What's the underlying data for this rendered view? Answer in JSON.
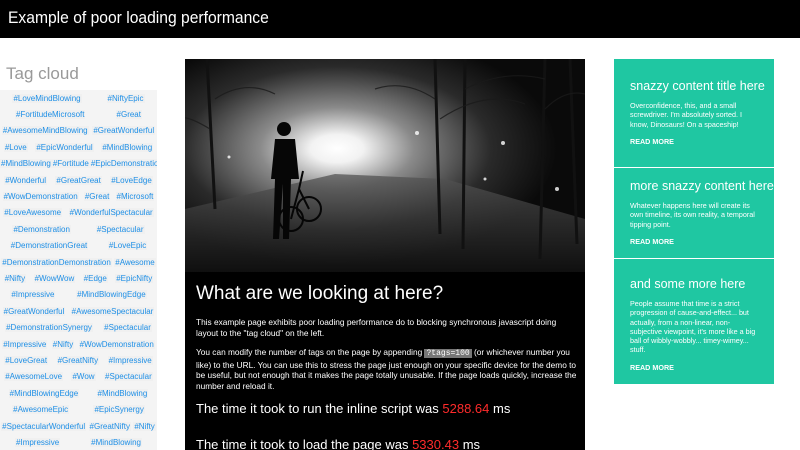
{
  "header": {
    "title": "Example of poor loading performance"
  },
  "tagcloud": {
    "title": "Tag cloud",
    "rows": [
      [
        "#LoveMindBlowing",
        "#NiftyEpic"
      ],
      [
        "#FortitudeMicrosoft",
        "#Great"
      ],
      [
        "#AwesomeMindBlowing",
        "#GreatWonderful"
      ],
      [
        "#Love",
        "#EpicWonderful",
        "#MindBlowing"
      ],
      [
        "#MindBlowing",
        "#Fortitude",
        "#EpicDemonstration"
      ],
      [
        "#Wonderful",
        "#GreatGreat",
        "#LoveEdge"
      ],
      [
        "#WowDemonstration",
        "#Great",
        "#Microsoft"
      ],
      [
        "#LoveAwesome",
        "#WonderfulSpectacular"
      ],
      [
        "#Demonstration",
        "#Spectacular"
      ],
      [
        "#DemonstrationGreat",
        "#LoveEpic"
      ],
      [
        "#DemonstrationDemonstration",
        "#Awesome"
      ],
      [
        "#Nifty",
        "#WowWow",
        "#Edge",
        "#EpicNifty"
      ],
      [
        "#Impressive",
        "#MindBlowingEdge"
      ],
      [
        "#GreatWonderful",
        "#AwesomeSpectacular"
      ],
      [
        "#DemonstrationSynergy",
        "#Spectacular"
      ],
      [
        "#Impressive",
        "#Nifty",
        "#WowDemonstration"
      ],
      [
        "#LoveGreat",
        "#GreatNifty",
        "#Impressive"
      ],
      [
        "#AwesomeLove",
        "#Wow",
        "#Spectacular"
      ],
      [
        "#MindBlowingEdge",
        "#MindBlowing"
      ],
      [
        "#AwesomeEpic",
        "#EpicSynergy"
      ],
      [
        "#SpectacularWonderful",
        "#GreatNifty",
        "#Nifty"
      ],
      [
        "#Impressive",
        "#MindBlowing"
      ]
    ]
  },
  "main": {
    "heading": "What are we looking at here?",
    "intro": "This example page exhibits poor loading performance do to blocking synchronous javascript doing layout to the \"tag cloud\" on the left.",
    "modify_before": "You can modify the number of tags on the page by appending ",
    "modify_code": "?tags=100",
    "modify_after": " (or whichever number you like) to the URL. You can use this to stress the page just enough on your specific device for the demo to be useful, but not enough that it makes the page totally unusable. If the page loads quickly, increase the number and reload it.",
    "inline_label": "The time it took to run the inline script was ",
    "inline_value": "5288.64",
    "inline_unit": " ms",
    "load_label": "The time it took to load the page was ",
    "load_value": "5330.43",
    "load_unit": " ms"
  },
  "sidebar": [
    {
      "title": "snazzy content title here",
      "body": "Overconfidence, this, and a small screwdriver. I'm absolutely sorted. I know, Dinosaurs! On a spaceship!",
      "more": "READ MORE"
    },
    {
      "title": "more snazzy content here",
      "body": "Whatever happens here will create its own timeline, its own reality, a temporal tipping point.",
      "more": "READ MORE"
    },
    {
      "title": "and some more here",
      "body": "People assume that time is a strict progression of cause-and-effect... but actually, from a non-linear, non-subjective viewpoint, it's more like a big ball of wibbly-wobbly... timey-wimey... stuff.",
      "more": "READ MORE"
    }
  ],
  "colors": {
    "accent": "#1fc7a2",
    "tag": "#1e8fe6",
    "timing": "#ff2b2b"
  }
}
